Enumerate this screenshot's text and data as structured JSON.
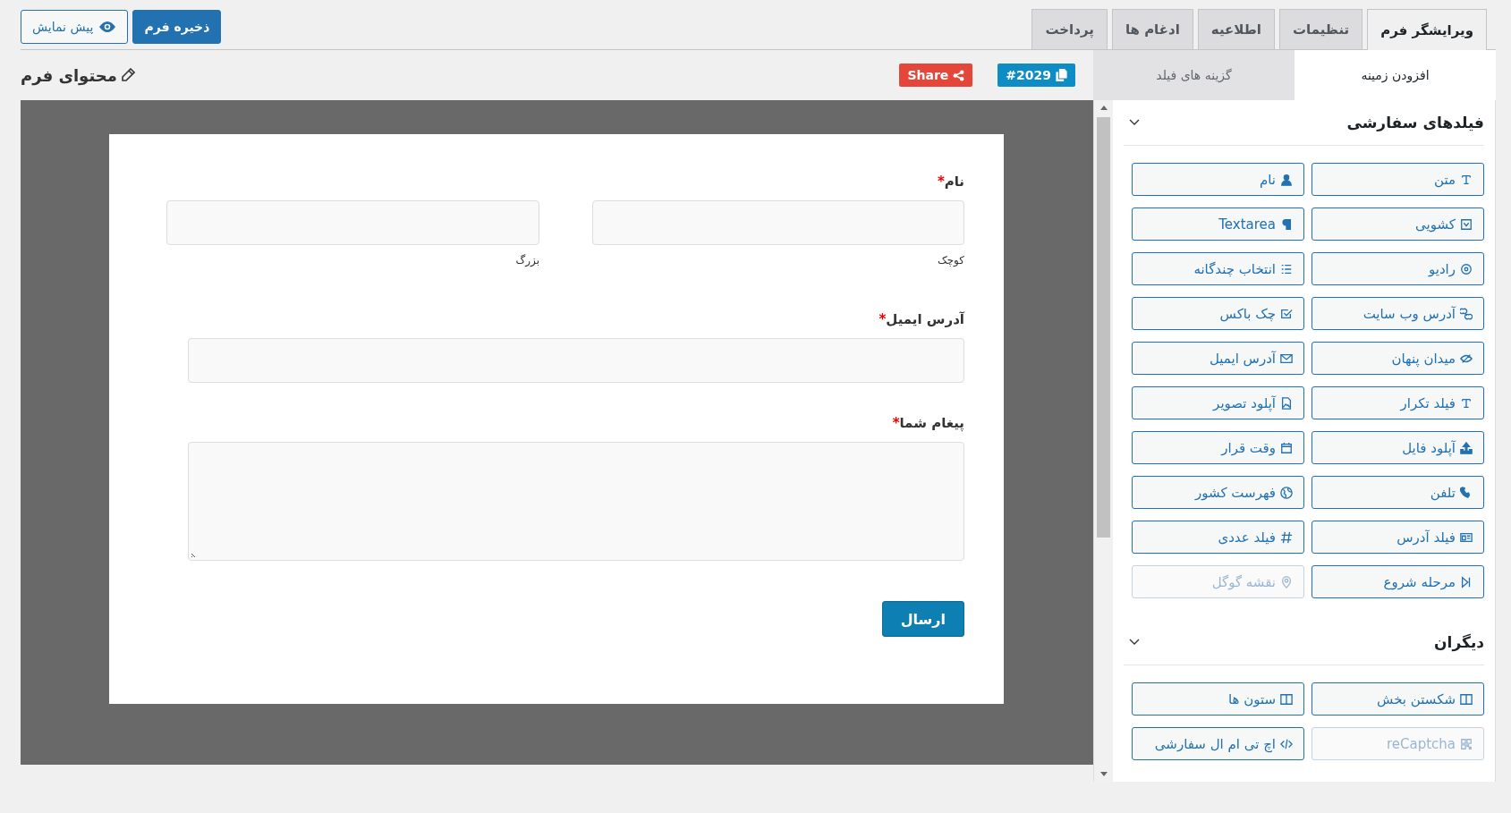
{
  "top_actions": [
    {
      "label": "ذخیره فرم",
      "kind": "primary"
    },
    {
      "label": "پیش نمایش",
      "kind": "preview"
    }
  ],
  "tabs": [
    {
      "label": "ویرایشگر فرم",
      "selected": true
    },
    {
      "label": "تنظیمات",
      "selected": false
    },
    {
      "label": "اطلاعیه",
      "selected": false
    },
    {
      "label": "ادغام ها",
      "selected": false
    },
    {
      "label": "پرداخت",
      "selected": false
    }
  ],
  "sidebar": {
    "tabs": [
      {
        "label": "افزودن زمینه",
        "selected": true
      },
      {
        "label": "گزینه های فیلد",
        "selected": false
      }
    ],
    "sections": [
      {
        "title": "فیلدهای سفارشی",
        "expanded": true,
        "items": [
          {
            "label": "متن",
            "disabled": false
          },
          {
            "label": "نام",
            "disabled": false
          },
          {
            "label": "کشویی",
            "disabled": false
          },
          {
            "label": "Textarea",
            "disabled": false
          },
          {
            "label": "رادیو",
            "disabled": false
          },
          {
            "label": "انتخاب چندگانه",
            "disabled": false
          },
          {
            "label": "آدرس وب سایت",
            "disabled": false
          },
          {
            "label": "چک باکس",
            "disabled": false
          },
          {
            "label": "میدان پنهان",
            "disabled": false
          },
          {
            "label": "آدرس ایمیل",
            "disabled": false
          },
          {
            "label": "فیلد تکرار",
            "disabled": false
          },
          {
            "label": "آپلود تصویر",
            "disabled": false
          },
          {
            "label": "آپلود فایل",
            "disabled": false
          },
          {
            "label": "وقت قرار",
            "disabled": false
          },
          {
            "label": "تلفن",
            "disabled": false
          },
          {
            "label": "فهرست کشور",
            "disabled": false
          },
          {
            "label": "فیلد آدرس",
            "disabled": false
          },
          {
            "label": "فیلد عددی",
            "disabled": false
          },
          {
            "label": "مرحله شروع",
            "disabled": false
          },
          {
            "label": "نقشه گوگل",
            "disabled": true
          }
        ]
      },
      {
        "title": "دیگران",
        "expanded": true,
        "items": [
          {
            "label": "شکستن بخش",
            "disabled": false
          },
          {
            "label": "ستون ها",
            "disabled": false
          },
          {
            "label": "reCaptcha",
            "disabled": true
          },
          {
            "label": "اچ تی ام ال سفارشی",
            "disabled": false
          }
        ]
      }
    ]
  },
  "editor": {
    "title": "محتوای فرم",
    "form_id": "#2029",
    "share": "Share",
    "form": {
      "fields": [
        {
          "kind": "name",
          "label": "نام",
          "required_mark": "*",
          "sublabels": [
            "کوچک",
            "بزرگ"
          ]
        },
        {
          "kind": "email",
          "label": "آدرس ایمیل",
          "required_mark": "*"
        },
        {
          "kind": "textarea",
          "label": "پیغام شما",
          "required_mark": "*"
        }
      ],
      "submit": "ارسال"
    }
  }
}
